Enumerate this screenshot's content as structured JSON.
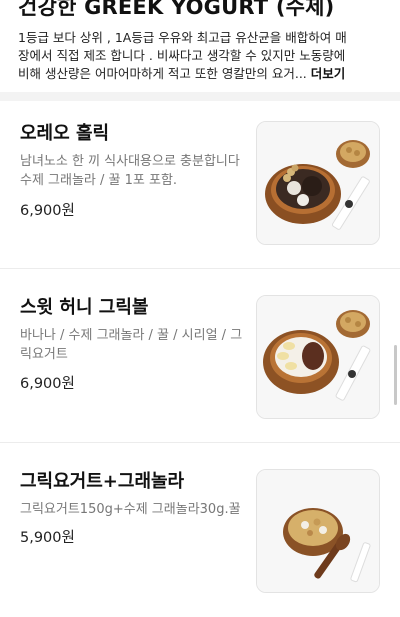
{
  "store": {
    "title": "건강한 GREEK YOGURT (수제)",
    "description_lines": [
      "1등급 보다 상위 , 1A등급 우유와 최고급 유산균을 배합하여  매",
      "장에서 직접 제조 합니다 . 비싸다고 생각할 수 있지만 노동량에",
      "비해 생산량은 어마어마하게 적고  또한 영칼만의 요거..."
    ],
    "more_label": "더보기"
  },
  "menu": [
    {
      "name": "오레오 홀릭",
      "desc_lines": [
        "남녀노소 한 끼 식사대용으로 충분합니다",
        "수제 그래놀라 / 꿀 1포 포함."
      ],
      "price": "6,900원"
    },
    {
      "name": "스윗 허니 그릭볼",
      "desc_lines": [
        "바나나 / 수제 그래놀라 / 꿀 / 시리얼 / 그",
        "릭요거트"
      ],
      "price": "6,900원"
    },
    {
      "name": "그릭요거트+그래놀라",
      "desc_lines": [
        "그릭요거트150g+수제 그래놀라30g.꿀"
      ],
      "price": "5,900원"
    }
  ]
}
